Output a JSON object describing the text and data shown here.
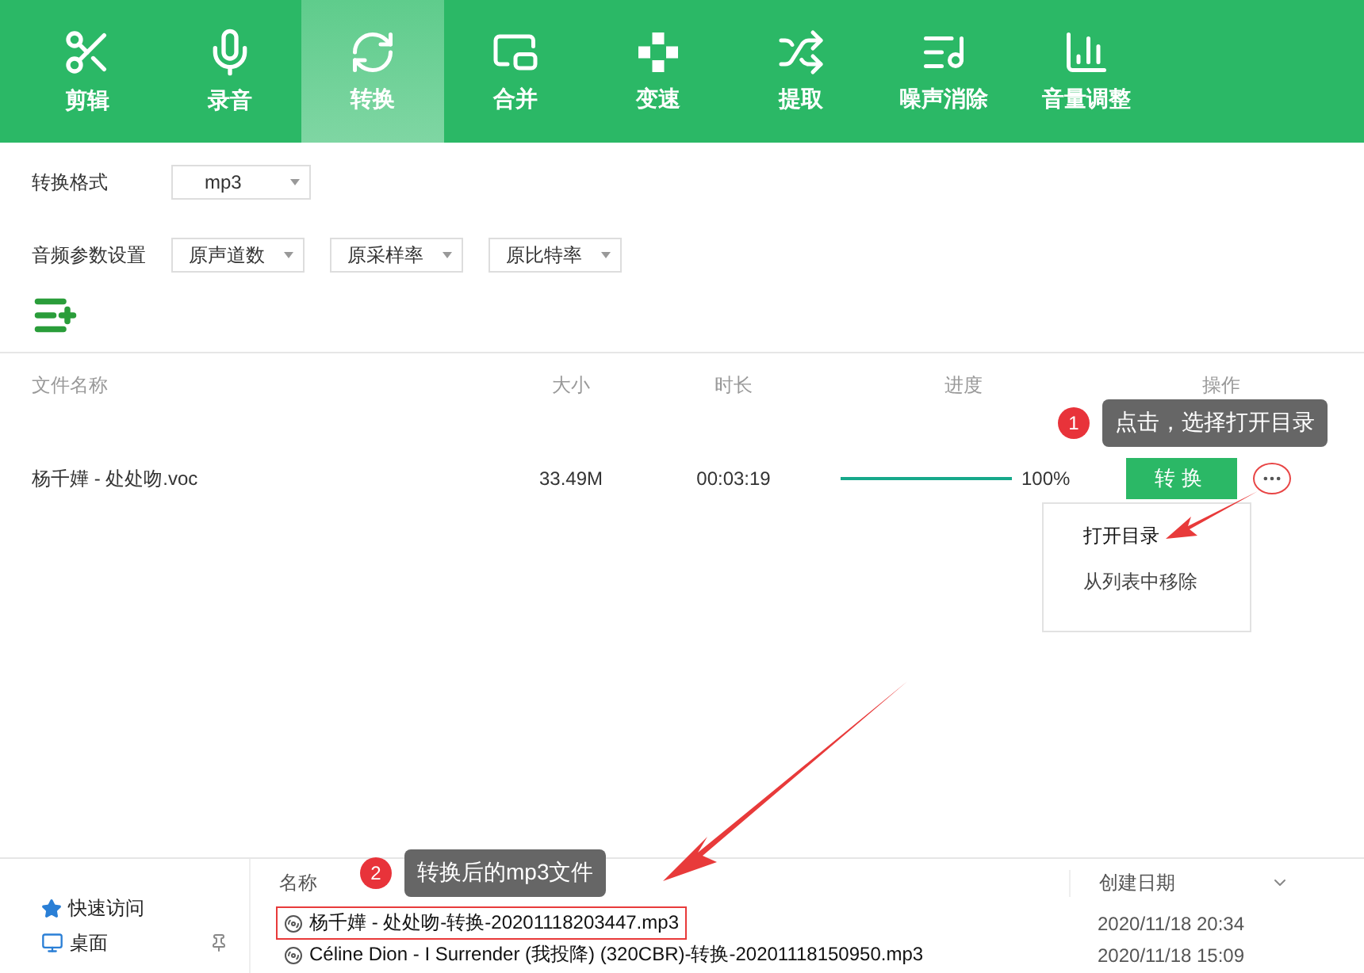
{
  "toolbar": {
    "tabs": [
      {
        "label": "剪辑",
        "selected": false
      },
      {
        "label": "录音",
        "selected": false
      },
      {
        "label": "转换",
        "selected": true
      },
      {
        "label": "合并",
        "selected": false
      },
      {
        "label": "变速",
        "selected": false
      },
      {
        "label": "提取",
        "selected": false
      },
      {
        "label": "噪声消除",
        "selected": false
      },
      {
        "label": "音量调整",
        "selected": false
      }
    ]
  },
  "settings": {
    "format": {
      "label": "转换格式",
      "value": "mp3"
    },
    "audio_params": {
      "label": "音频参数设置",
      "selects": [
        "原声道数",
        "原采样率",
        "原比特率"
      ]
    }
  },
  "table": {
    "columns": [
      "文件名称",
      "大小",
      "时长",
      "进度",
      "操作"
    ],
    "rows": [
      {
        "name": "杨千嬅 - 处处吻.voc",
        "size": "33.49M",
        "duration": "00:03:19",
        "level": 1,
        "progress_text": "100%",
        "action": "转换"
      }
    ]
  },
  "context_menu": {
    "items": [
      "打开目录",
      "从列表中移除"
    ]
  },
  "annotations": [
    {
      "number": "1",
      "text": "点击，选择打开目录"
    },
    {
      "number": "2",
      "text": "转换后的mp3文件"
    }
  ],
  "explorer": {
    "sidebar": [
      {
        "label": "快速访问",
        "pinned": false
      },
      {
        "label": "桌面",
        "pinned": true
      }
    ],
    "columns": [
      "名称",
      "创建日期"
    ],
    "files": [
      {
        "name": "杨千嬅 - 处处吻-转换-20201118203447.mp3",
        "date": "2020/11/18 20:34",
        "highlighted": true
      },
      {
        "name": "Céline Dion - I Surrender (我投降) (320CBR)-转换-20201118150950.mp3",
        "date": "2020/11/18 15:09",
        "highlighted": false
      }
    ]
  }
}
